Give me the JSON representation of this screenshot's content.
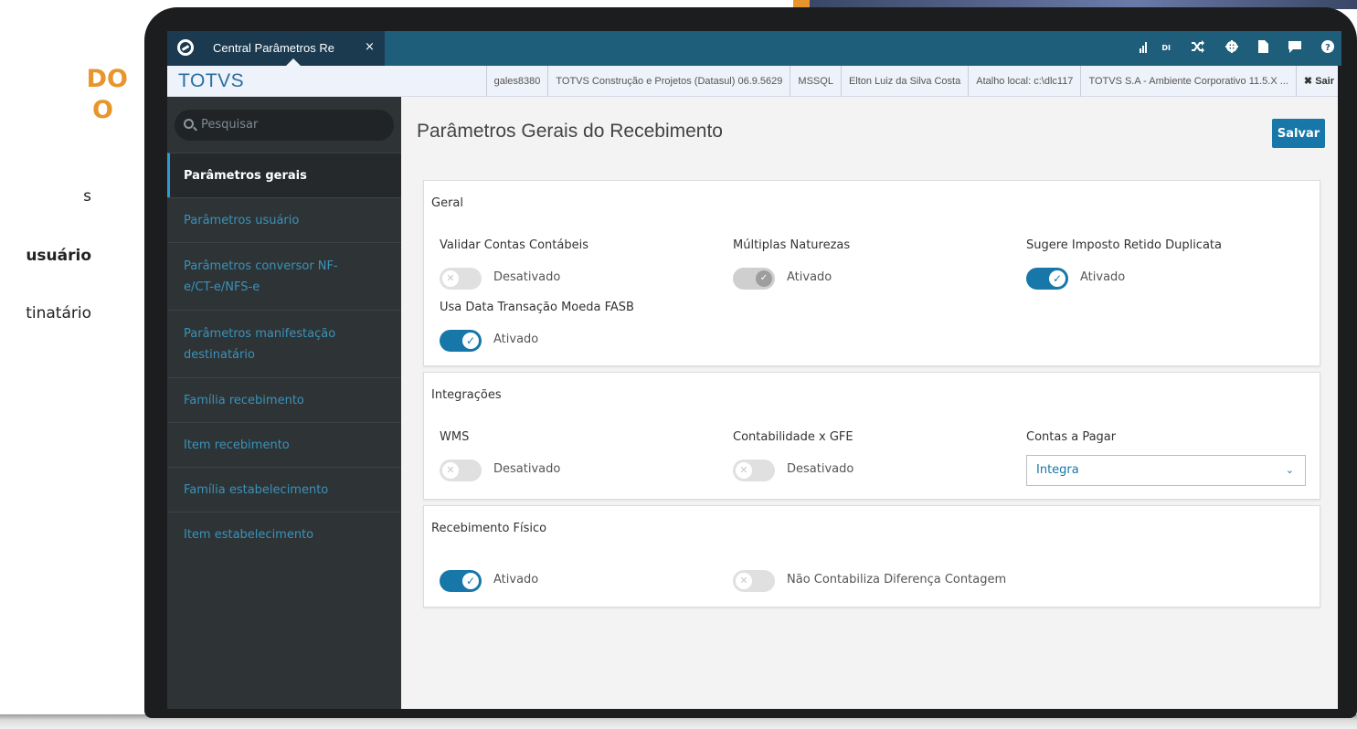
{
  "slide": {
    "title_line1": "DO",
    "title_line2": "O",
    "item1": "s",
    "item2": "usuário",
    "item3": "tinatário"
  },
  "titlebar": {
    "tab_label": "Central Parâmetros Re",
    "tab_close": "×",
    "icons": [
      "signal-icon",
      "shuffle-icon",
      "gear-icon",
      "file-icon",
      "chat-icon",
      "help-icon"
    ],
    "signal_badge": "DI"
  },
  "infobar": {
    "brand": "TOTVS",
    "user": "gales8380",
    "product": "TOTVS Construção e Projetos (Datasul) 06.9.5629",
    "database": "MSSQL",
    "name": "Elton Luiz da Silva Costa",
    "shortcut": "Atalho local: c:\\dlc117",
    "environment": "TOTVS S.A - Ambiente Corporativo 11.5.X ...",
    "logout": "✖ Sair"
  },
  "sidebar": {
    "search_placeholder": "Pesquisar",
    "items": [
      {
        "label": "Parâmetros gerais"
      },
      {
        "label": "Parâmetros usuário"
      },
      {
        "label": "Parâmetros conversor NF-e/CT-e/NFS-e"
      },
      {
        "label": "Parâmetros manifestação destinatário"
      },
      {
        "label": "Família recebimento"
      },
      {
        "label": "Item recebimento"
      },
      {
        "label": "Família estabelecimento"
      },
      {
        "label": "Item estabelecimento"
      }
    ]
  },
  "main": {
    "title": "Parâmetros Gerais do Recebimento",
    "save_label": "Salvar",
    "geral": {
      "title": "Geral",
      "f1_label": "Validar Contas Contábeis",
      "f1_state": "Desativado",
      "f2_label": "Múltiplas Naturezas",
      "f2_state": "Ativado",
      "f3_label": "Sugere Imposto Retido Duplicata",
      "f3_state": "Ativado",
      "f4_label": "Usa Data Transação Moeda FASB",
      "f4_state": "Ativado"
    },
    "integracoes": {
      "title": "Integrações",
      "f1_label": "WMS",
      "f1_state": "Desativado",
      "f2_label": "Contabilidade x GFE",
      "f2_state": "Desativado",
      "f3_label": "Contas a Pagar",
      "f3_value": "Integra"
    },
    "fisico": {
      "title": "Recebimento Físico",
      "f1_state": "Ativado",
      "f2_state": "Não Contabiliza Diferença Contagem"
    }
  },
  "colors": {
    "accent": "#1777a8",
    "brand": "#2a6fa0",
    "slide_orange": "#e8952d",
    "sidebar_bg": "#2e3336",
    "sidebar_link": "#3a93b8"
  }
}
